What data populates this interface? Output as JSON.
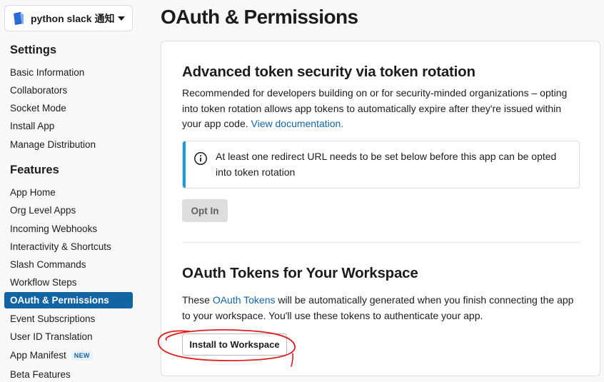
{
  "app_selector": {
    "name": "python slack 通知"
  },
  "sidebar": {
    "settings_heading": "Settings",
    "settings_items": [
      "Basic Information",
      "Collaborators",
      "Socket Mode",
      "Install App",
      "Manage Distribution"
    ],
    "features_heading": "Features",
    "features_items": [
      {
        "label": "App Home"
      },
      {
        "label": "Org Level Apps"
      },
      {
        "label": "Incoming Webhooks"
      },
      {
        "label": "Interactivity & Shortcuts"
      },
      {
        "label": "Slash Commands"
      },
      {
        "label": "Workflow Steps"
      },
      {
        "label": "OAuth & Permissions",
        "active": true
      },
      {
        "label": "Event Subscriptions"
      },
      {
        "label": "User ID Translation"
      },
      {
        "label": "App Manifest",
        "badge": "NEW"
      },
      {
        "label": "Beta Features"
      }
    ]
  },
  "page": {
    "title": "OAuth & Permissions"
  },
  "token_rotation": {
    "heading": "Advanced token security via token rotation",
    "description": "Recommended for developers building on or for security-minded organizations – opting into token rotation allows app tokens to automatically expire after they're issued within your app code.",
    "doc_link": "View documentation.",
    "alert_text": "At least one redirect URL needs to be set below before this app can be opted into token rotation",
    "opt_in_label": "Opt In"
  },
  "oauth_tokens": {
    "heading": "OAuth Tokens for Your Workspace",
    "text_before": "These ",
    "link": "OAuth Tokens",
    "text_after": " will be automatically generated when you finish connecting the app to your workspace. You'll use these tokens to authenticate your app.",
    "install_label": "Install to Workspace"
  },
  "colors": {
    "accent": "#1264a3",
    "alert_stripe": "#1d9bd1",
    "annotation": "#e01e1e"
  },
  "icons": {
    "app_icon": "blue-notebook-icon",
    "caret": "caret-down-icon",
    "info": "info-icon"
  }
}
